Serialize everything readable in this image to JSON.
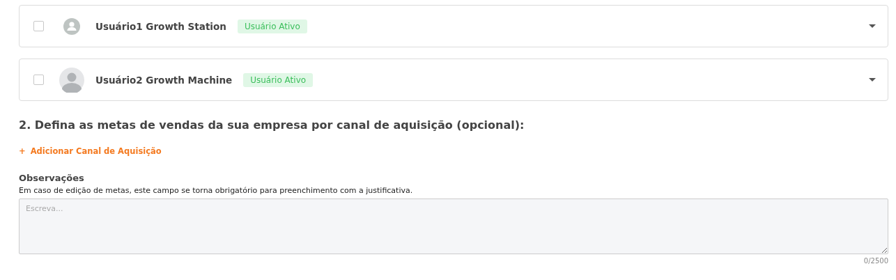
{
  "users": [
    {
      "name": "Usuário1 Growth Station",
      "status": "Usuário Ativo",
      "checked": false,
      "avatar": {
        "kind": "icon"
      },
      "expanded": false
    },
    {
      "name": "Usuário2 Growth Machine",
      "status": "Usuário Ativo",
      "checked": false,
      "avatar": {
        "kind": "silhouette"
      },
      "expanded": false
    }
  ],
  "section": {
    "title": "2. Defina as metas de vendas da sua empresa por canal de aquisição (opcional):",
    "add_link": {
      "icon": "+",
      "label": "Adicionar Canal de Aquisição"
    }
  },
  "observations": {
    "label": "Observações",
    "hint": "Em caso de edição de metas, este campo se torna obrigatório para preenchimento com a justificativa.",
    "placeholder": "Escreva...",
    "counter": "0/2500"
  }
}
